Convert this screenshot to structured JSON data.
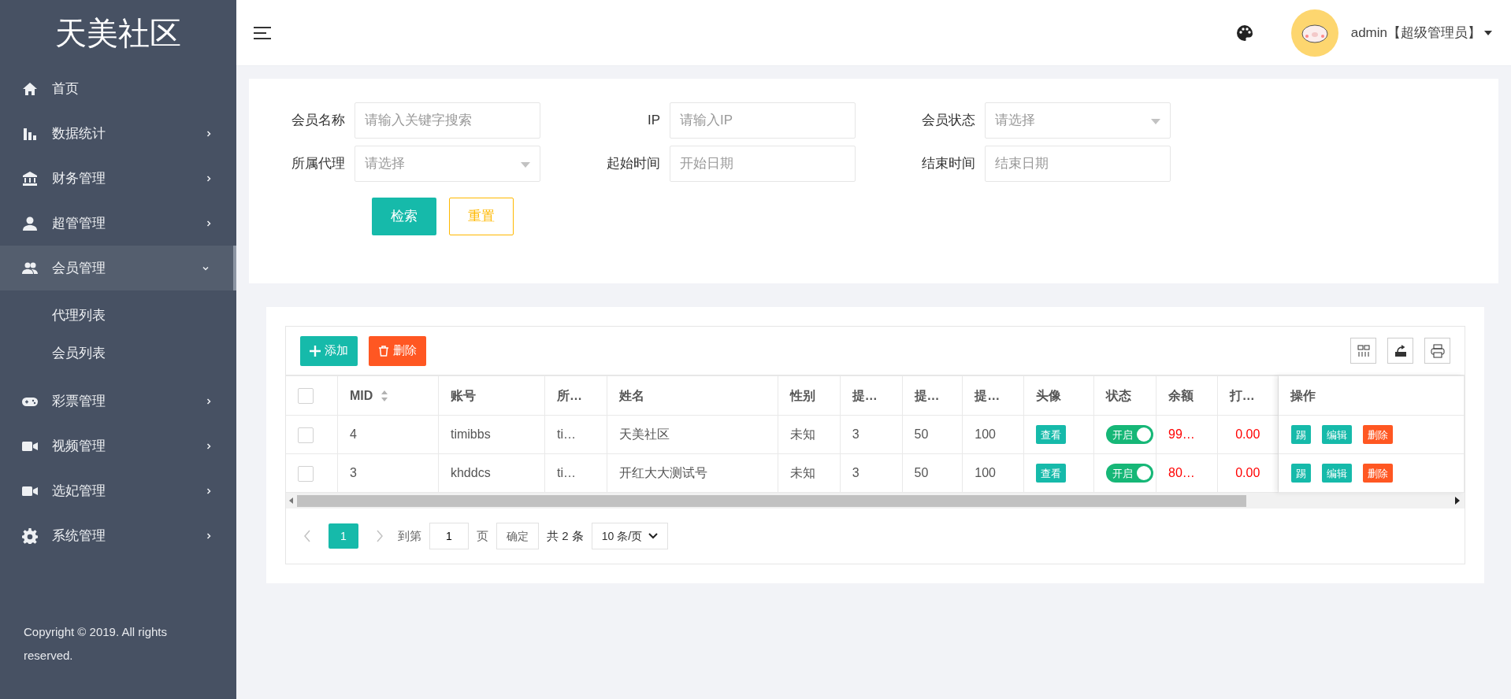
{
  "sidebar": {
    "logo": "天美社区",
    "items": [
      {
        "label": "首页",
        "expandable": false,
        "selected": false
      },
      {
        "label": "数据统计",
        "expandable": true,
        "expanded": false,
        "selected": false
      },
      {
        "label": "财务管理",
        "expandable": true,
        "expanded": false,
        "selected": false
      },
      {
        "label": "超管管理",
        "expandable": true,
        "expanded": false,
        "selected": false
      },
      {
        "label": "会员管理",
        "expandable": true,
        "expanded": true,
        "selected": true,
        "children": [
          {
            "label": "代理列表"
          },
          {
            "label": "会员列表"
          }
        ]
      },
      {
        "label": "彩票管理",
        "expandable": true,
        "expanded": false,
        "selected": false
      },
      {
        "label": "视频管理",
        "expandable": true,
        "expanded": false,
        "selected": false
      },
      {
        "label": "选妃管理",
        "expandable": true,
        "expanded": false,
        "selected": false
      },
      {
        "label": "系统管理",
        "expandable": true,
        "expanded": false,
        "selected": false
      }
    ],
    "copyright": "Copyright © 2019. All rights reserved."
  },
  "header": {
    "user": "admin【超级管理员】"
  },
  "search_form": {
    "fields": [
      {
        "label": "会员名称",
        "kind": "text",
        "placeholder": "请输入关键字搜索"
      },
      {
        "label": "IP",
        "kind": "text",
        "placeholder": "请输入IP"
      },
      {
        "label": "会员状态",
        "kind": "select",
        "placeholder": "请选择"
      },
      {
        "label": "所属代理",
        "kind": "select",
        "placeholder": "请选择"
      },
      {
        "label": "起始时间",
        "kind": "text",
        "placeholder": "开始日期"
      },
      {
        "label": "结束时间",
        "kind": "text",
        "placeholder": "结束日期"
      }
    ],
    "buttons": [
      {
        "label": "检索",
        "kind": "primary"
      },
      {
        "label": "重置",
        "kind": "outline"
      }
    ]
  },
  "table": {
    "all_checked": false,
    "toolbar": [
      {
        "label": "添加",
        "kind": "add"
      },
      {
        "label": "删除",
        "kind": "delete"
      }
    ],
    "columns": [
      {
        "label": "MID",
        "sortable": true
      },
      {
        "label": "账号",
        "sortable": false
      },
      {
        "label": "所…",
        "sortable": false
      },
      {
        "label": "姓名",
        "sortable": false
      },
      {
        "label": "性别",
        "sortable": false
      },
      {
        "label": "提…",
        "sortable": false
      },
      {
        "label": "提…",
        "sortable": false
      },
      {
        "label": "提…",
        "sortable": false
      },
      {
        "label": "头像",
        "sortable": false
      },
      {
        "label": "状态",
        "sortable": false
      },
      {
        "label": "余额",
        "sortable": false
      },
      {
        "label": "打…",
        "sortable": false
      },
      {
        "label": "操作",
        "sortable": false
      }
    ],
    "rows": [
      {
        "checked": false,
        "cells": [
          "4",
          "timibbs",
          "ti…",
          "天美社区",
          "未知",
          "3",
          "50",
          "100"
        ],
        "avatar_button": "查看",
        "status": {
          "label": "开启",
          "on": true
        },
        "balance": "99…",
        "bet": "0.00",
        "actions": [
          {
            "label": "踢",
            "kind": "primary"
          },
          {
            "label": "编辑",
            "kind": "primary"
          },
          {
            "label": "删除",
            "kind": "danger"
          }
        ]
      },
      {
        "checked": false,
        "cells": [
          "3",
          "khddcs",
          "ti…",
          "开红大大测试号",
          "未知",
          "3",
          "50",
          "100"
        ],
        "avatar_button": "查看",
        "status": {
          "label": "开启",
          "on": true
        },
        "balance": "80…",
        "bet": "0.00",
        "actions": [
          {
            "label": "踢",
            "kind": "primary"
          },
          {
            "label": "编辑",
            "kind": "primary"
          },
          {
            "label": "删除",
            "kind": "danger"
          }
        ]
      }
    ],
    "pagination": {
      "pages": [
        {
          "label": "1",
          "selected": true
        }
      ],
      "goto_label": "到第",
      "goto_value": "1",
      "page_unit": "页",
      "confirm": "确定",
      "total": "共 2 条",
      "page_size": "10 条/页"
    }
  }
}
